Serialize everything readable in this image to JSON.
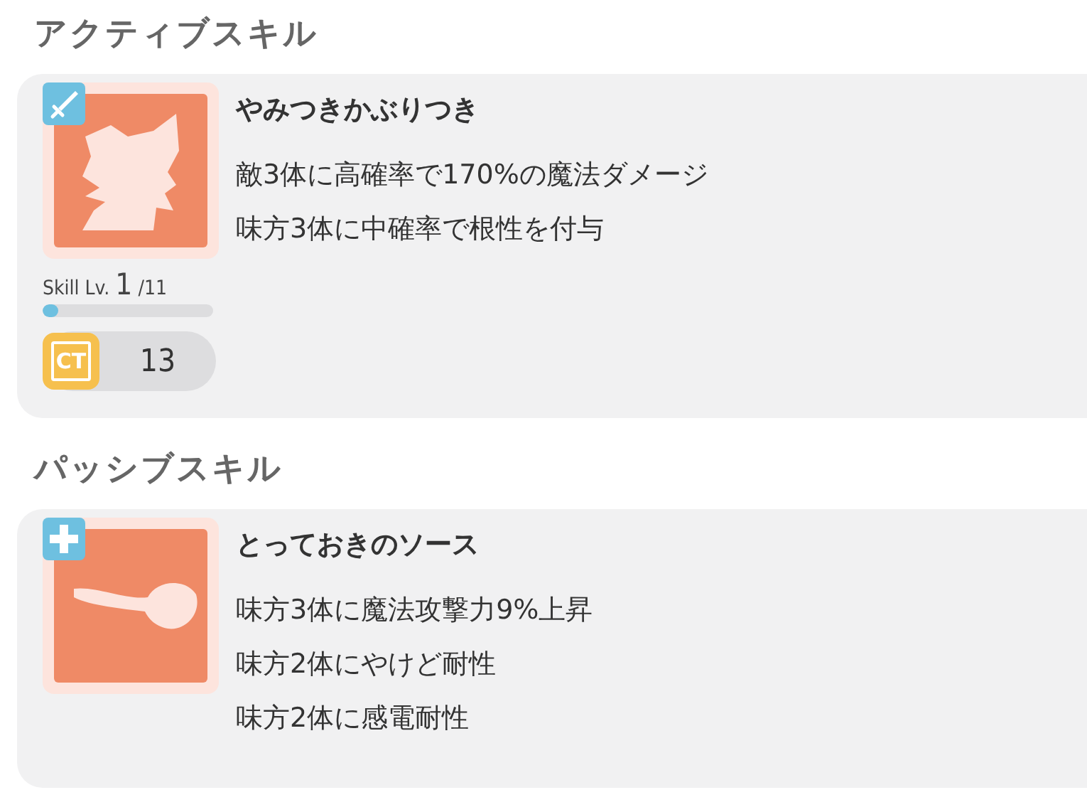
{
  "sections": [
    {
      "title": "アクティブスキル",
      "skill": {
        "badge": {
          "kind": "sword"
        },
        "icon": {
          "kind": "beast"
        },
        "name": "やみつきかぶりつき",
        "description": [
          "敵3体に高確率で170%の魔法ダメージ",
          "味方3体に中確率で根性を付与"
        ],
        "skill_level": {
          "label": "Skill Lv.",
          "current": "1",
          "max": "/11",
          "level": 0.09
        },
        "cooldown": {
          "label": "CT",
          "value": "13"
        }
      }
    },
    {
      "title": "パッシブスキル",
      "skill": {
        "badge": {
          "kind": "plus"
        },
        "icon": {
          "kind": "spoon"
        },
        "name": "とっておきのソース",
        "description": [
          "味方3体に魔法攻撃力9%上昇",
          "味方2体にやけど耐性",
          "味方2体に感電耐性"
        ]
      }
    }
  ]
}
